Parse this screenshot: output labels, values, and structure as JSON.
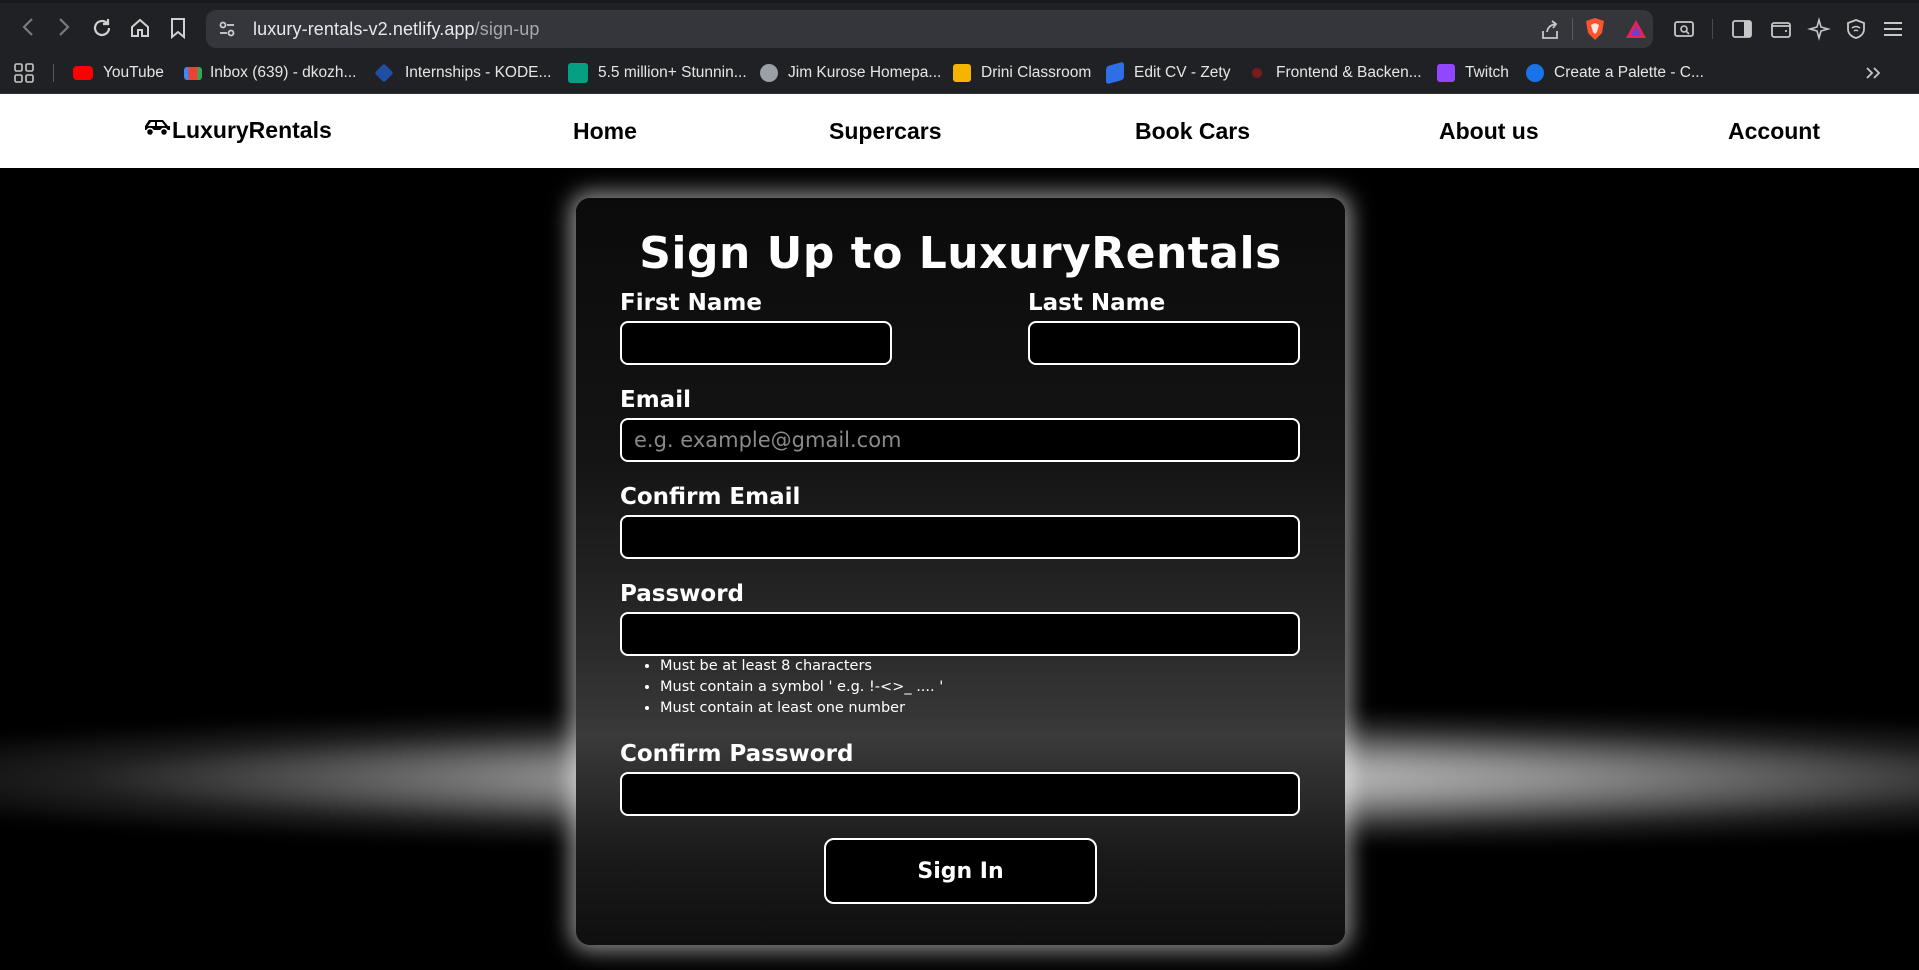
{
  "browser": {
    "url_host": "luxury-rentals-v2.netlify.app",
    "url_path": "/sign-up",
    "bookmarks": [
      {
        "label": "YouTube",
        "color": "#ff0000"
      },
      {
        "label": "Inbox (639) - dkozh...",
        "color": "#ea4335"
      },
      {
        "label": "Internships - KODE...",
        "color": "#1f4fa3"
      },
      {
        "label": "5.5 million+ Stunnin...",
        "color": "#3aa857"
      },
      {
        "label": "Jim Kurose Homepa...",
        "color": "#9aa0a6"
      },
      {
        "label": "Drini Classroom",
        "color": "#f4b400"
      },
      {
        "label": "Edit CV - Zety",
        "color": "#2e6ee6"
      },
      {
        "label": "Frontend & Backen...",
        "color": "#7a1c1c"
      },
      {
        "label": "Twitch",
        "color": "#9146ff"
      },
      {
        "label": "Create a Palette - C...",
        "color": "#1a73e8"
      }
    ]
  },
  "nav": {
    "logo": "LuxuryRentals",
    "links": [
      "Home",
      "Supercars",
      "Book Cars",
      "About us",
      "Account"
    ]
  },
  "form": {
    "title": "Sign Up to LuxuryRentals",
    "first_name_label": "First Name",
    "last_name_label": "Last Name",
    "email_label": "Email",
    "email_placeholder": "e.g. example@gmail.com",
    "confirm_email_label": "Confirm Email",
    "password_label": "Password",
    "password_rules": [
      "Must be at least 8 characters",
      "Must contain a symbol ' e.g. !-<>_ .... '",
      "Must contain at least one number"
    ],
    "confirm_password_label": "Confirm Password",
    "submit_label": "Sign In"
  }
}
